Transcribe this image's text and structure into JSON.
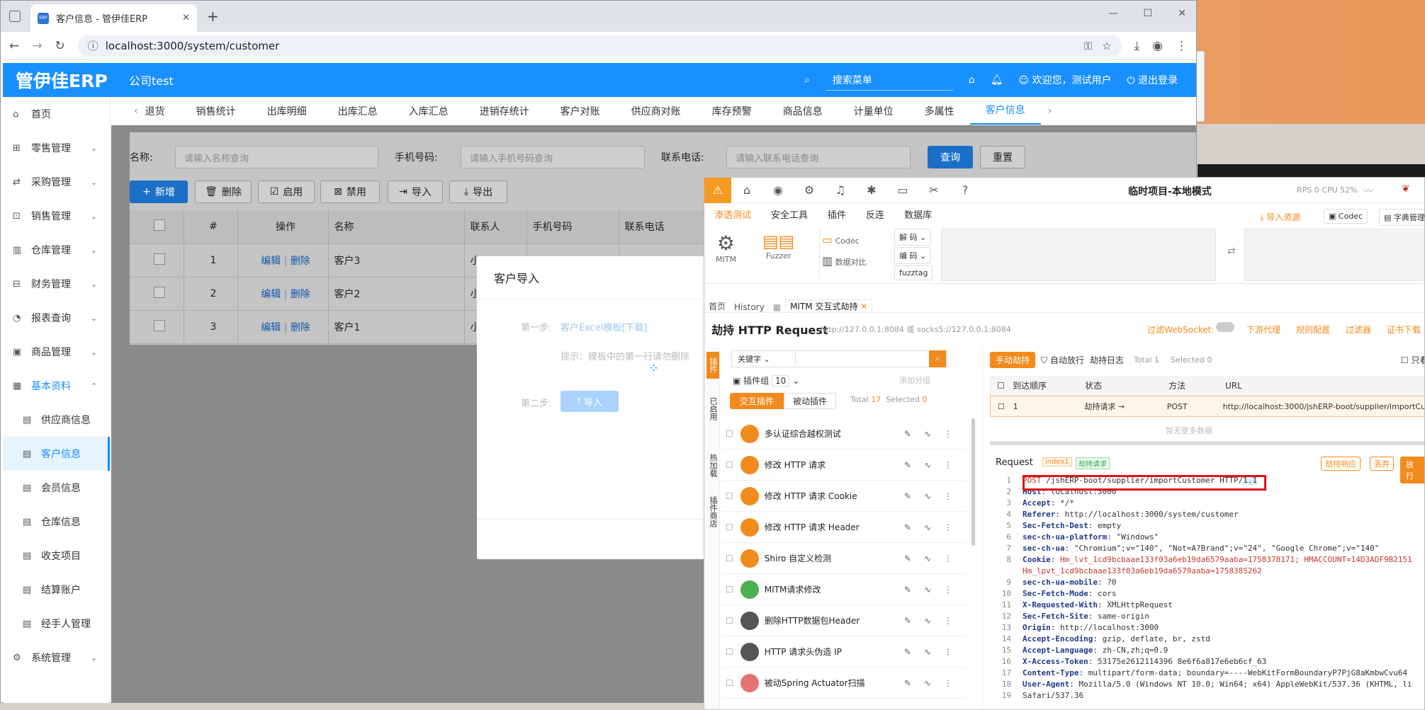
{
  "browser": {
    "tab_title": "客户信息 - 管伊佳ERP",
    "favicon": "ERP",
    "url": "localhost:3000/system/customer"
  },
  "app": {
    "logo": "管伊佳ERP",
    "company": "公司test",
    "search_placeholder": "搜索菜单",
    "welcome": "欢迎您，测试用户",
    "logout": "退出登录",
    "accent": "#1890ff"
  },
  "sidebar": [
    {
      "label": "首页",
      "icon": "home-icon"
    },
    {
      "label": "零售管理",
      "icon": "shop-icon"
    },
    {
      "label": "采购管理",
      "icon": "swap-icon"
    },
    {
      "label": "销售管理",
      "icon": "cart-icon"
    },
    {
      "label": "仓库管理",
      "icon": "warehouse-icon"
    },
    {
      "label": "财务管理",
      "icon": "money-icon"
    },
    {
      "label": "报表查询",
      "icon": "chart-icon"
    },
    {
      "label": "商品管理",
      "icon": "box-icon"
    },
    {
      "label": "基本资料",
      "icon": "grid-icon"
    },
    {
      "label": "供应商信息",
      "icon": "doc-icon"
    },
    {
      "label": "客户信息",
      "icon": "doc-icon"
    },
    {
      "label": "会员信息",
      "icon": "doc-icon"
    },
    {
      "label": "仓库信息",
      "icon": "doc-icon"
    },
    {
      "label": "收支项目",
      "icon": "doc-icon"
    },
    {
      "label": "结算账户",
      "icon": "doc-icon"
    },
    {
      "label": "经手人管理",
      "icon": "doc-icon"
    },
    {
      "label": "系统管理",
      "icon": "gear-icon"
    }
  ],
  "tabs": [
    "退货",
    "销售统计",
    "出库明细",
    "出库汇总",
    "入库汇总",
    "进销存统计",
    "客户对账",
    "供应商对账",
    "库存预警",
    "商品信息",
    "计量单位",
    "多属性",
    "客户信息"
  ],
  "filters": {
    "name_label": "名称:",
    "name_placeholder": "请输入名称查询",
    "phone_label": "手机号码:",
    "phone_placeholder": "请输入手机号码查询",
    "tel_label": "联系电话:",
    "tel_placeholder": "请输入联系电话查询",
    "query": "查询",
    "reset": "重置"
  },
  "toolbar": [
    "新增",
    "删除",
    "启用",
    "禁用",
    "导入",
    "导出"
  ],
  "table": {
    "headers": [
      "#",
      "操作",
      "名称",
      "联系人",
      "手机号码",
      "联系电话"
    ],
    "edit": "编辑",
    "delete": "删除",
    "rows": [
      {
        "no": "1",
        "name": "客户3",
        "contact": "小 ..."
      },
      {
        "no": "2",
        "name": "客户2",
        "contact": "小"
      },
      {
        "no": "3",
        "name": "客户1",
        "contact": "小"
      }
    ]
  },
  "modal": {
    "title": "客户导入",
    "step1_label": "第一步:",
    "step1_link": "客户Excel模板[下载]",
    "hint": "提示：模板中的第一行请勿删除",
    "step2_label": "第二步:",
    "step2_btn": "导入"
  },
  "yakit": {
    "title": "临时项目-本地模式",
    "rps": "RPS 0",
    "cpu": "CPU 52%",
    "menu": [
      "渗透测试",
      "安全工具",
      "插件",
      "反连",
      "数据库"
    ],
    "import_res": "导入资源",
    "codec": "Codec",
    "dict": "字典管理",
    "tools": [
      "MITM",
      "Fuzzer",
      "Codec",
      "数据对比"
    ],
    "decode": "解 码",
    "encode": "编 码",
    "fuzztag": "fuzztag",
    "subtabs": [
      "首页",
      "History",
      "MITM 交互式劫持"
    ],
    "hijack_title": "劫持 HTTP Request",
    "hijack_addr": "http://127.0.0.1:8084 或 socks5://127.0.0.1:8084",
    "filter_ws": "过滤WebSocket:",
    "links": [
      "下游代理",
      "规则配置",
      "过滤器",
      "证书下载"
    ],
    "keyword": "关键字",
    "plugin_group": "插件组",
    "plugin_group_count": "10",
    "add_group": "添加分组",
    "plugin_tabs": [
      "交互插件",
      "被动插件"
    ],
    "total": "Total",
    "total_n": "17",
    "selected": "Selected",
    "selected_n": "0",
    "side_tabs": [
      "插件",
      "已启用",
      "热加载",
      "插件商店"
    ],
    "plugins": [
      "多认证综合越权测试",
      "修改 HTTP 请求",
      "修改 HTTP 请求 Cookie",
      "修改 HTTP 请求 Header",
      "Shiro 自定义检测",
      "MITM请求修改",
      "删除HTTP数据包Header",
      "HTTP 请求头伪造 IP",
      "被动Spring Actuator扫描"
    ],
    "hijack_modes": [
      "手动劫持",
      "自动放行",
      "劫持日志"
    ],
    "right_total": "Total 1",
    "right_selected": "Selected 0",
    "only_see": "只看",
    "req_headers": [
      "到达顺序",
      "状态",
      "方法",
      "URL"
    ],
    "req_row": {
      "no": "1",
      "status": "劫持请求 →",
      "method": "POST",
      "url": "http://localhost:3000/jshERP-boot/supplier/importCu"
    },
    "no_more": "暂无更多数据",
    "request_label": "Request",
    "tag1": "index1",
    "tag2": "劫持请求",
    "act1": "劫持响应",
    "act2": "丢弃",
    "act3": "放行",
    "code": [
      "POST /jshERP-boot/supplier/importCustomer HTTP/1.1",
      "Host: localhost:3000",
      "Accept: */*",
      "Referer: http://localhost:3000/system/customer",
      "Sec-Fetch-Dest: empty",
      "sec-ch-ua-platform: \"Windows\"",
      "sec-ch-ua: \"Chromium\";v=\"140\", \"Not=A?Brand\";v=\"24\", \"Google Chrome\";v=\"140\"",
      "Cookie: Hm_lvt_1cd9bcbaae133f03a6eb19da6579aaba=1758378171; HMACCOUNT=14D3ADF9B2151",
      "Hm_lpvt_1cd9bcbaae133f03a6eb19da6579aaba=1758385262",
      "sec-ch-ua-mobile: ?0",
      "Sec-Fetch-Mode: cors",
      "X-Requested-With: XMLHttpRequest",
      "Sec-Fetch-Site: same-origin",
      "Origin: http://localhost:3000",
      "Accept-Encoding: gzip, deflate, br, zstd",
      "Accept-Language: zh-CN,zh;q=0.9",
      "X-Access-Token: 53175e2612114396 8e6f6a817e6eb6cf_63",
      "Content-Type: multipart/form-data; boundary=----WebKitFormBoundaryP7PjG8aKmbwCvu64",
      "User-Agent: Mozilla/5.0 (Windows NT 10.0; Win64; x64) AppleWebKit/537.36 (KHTML, li",
      "Safari/537.36"
    ]
  }
}
